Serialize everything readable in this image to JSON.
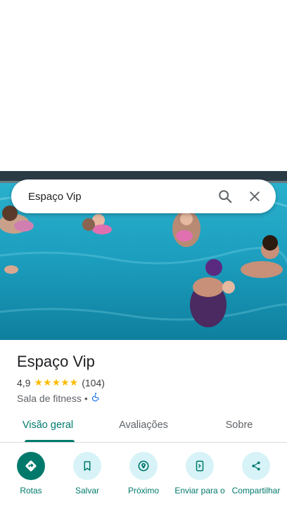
{
  "search": {
    "query": "Espaço Vip"
  },
  "place": {
    "name": "Espaço Vip",
    "rating": "4,9",
    "stars": "★★★★★",
    "review_count": "(104)",
    "category": "Sala de fitness",
    "separator": "•"
  },
  "tabs": [
    {
      "label": "Visão geral",
      "active": true
    },
    {
      "label": "Avaliações",
      "active": false
    },
    {
      "label": "Sobre",
      "active": false
    }
  ],
  "actions": [
    {
      "label": "Rotas",
      "icon": "directions-icon"
    },
    {
      "label": "Salvar",
      "icon": "bookmark-icon"
    },
    {
      "label": "Próximo",
      "icon": "nearby-icon"
    },
    {
      "label": "Enviar para o",
      "icon": "send-to-phone-icon"
    },
    {
      "label": "Compartilhar",
      "icon": "share-icon"
    }
  ],
  "colors": {
    "accent": "#00796b",
    "action_bg": "#d7f3f7",
    "stars": "#fbbc04",
    "pool": "#1fa6c4"
  }
}
